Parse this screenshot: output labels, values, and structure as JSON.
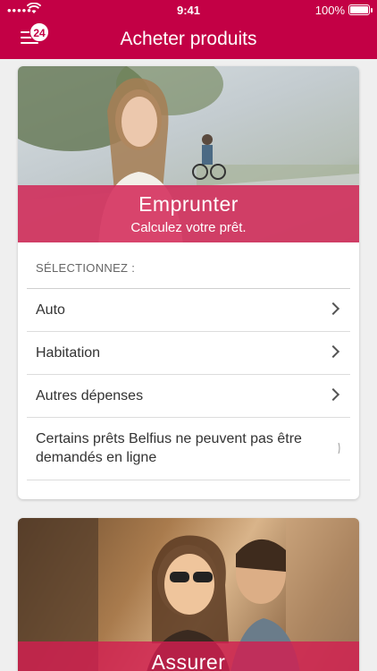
{
  "status_bar": {
    "carrier": "•••••",
    "time": "9:41",
    "battery": "100%"
  },
  "header": {
    "title": "Acheter produits",
    "notification_count": "24"
  },
  "emprunter": {
    "title": "Emprunter",
    "subtitle": "Calculez votre prêt.",
    "section_label": "SÉLECTIONNEZ :",
    "items": [
      {
        "label": "Auto"
      },
      {
        "label": "Habitation"
      },
      {
        "label": "Autres dépenses"
      }
    ],
    "note": "Certains prêts Belfius ne peuvent pas être demandés en ligne"
  },
  "assurer": {
    "title": "Assurer"
  },
  "colors": {
    "brand": "#c30045",
    "band": "#d21e50"
  }
}
